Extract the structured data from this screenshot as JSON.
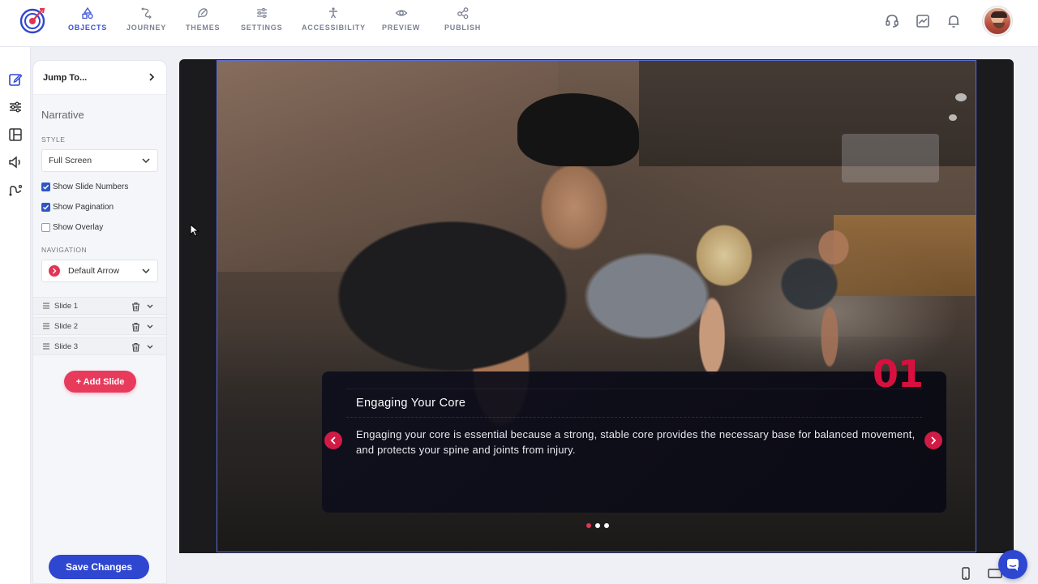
{
  "nav": {
    "items": [
      {
        "label": "OBJECTS",
        "icon": "shapes-icon",
        "active": true
      },
      {
        "label": "JOURNEY",
        "icon": "route-icon"
      },
      {
        "label": "THEMES",
        "icon": "palette-icon"
      },
      {
        "label": "SETTINGS",
        "icon": "sliders-icon"
      },
      {
        "label": "ACCESSIBILITY",
        "icon": "accessibility-icon"
      },
      {
        "label": "PREVIEW",
        "icon": "eye-icon"
      },
      {
        "label": "PUBLISH",
        "icon": "share-icon"
      }
    ]
  },
  "panel": {
    "jump_label": "Jump To...",
    "title": "Narrative",
    "style_label": "STYLE",
    "style_value": "Full Screen",
    "checkboxes": [
      {
        "label": "Show Slide Numbers",
        "checked": true
      },
      {
        "label": "Show Pagination",
        "checked": true
      },
      {
        "label": "Show Overlay",
        "checked": false
      }
    ],
    "navigation_label": "NAVIGATION",
    "navigation_value": "Default Arrow",
    "slides": [
      {
        "label": "Slide 1"
      },
      {
        "label": "Slide 2"
      },
      {
        "label": "Slide 3"
      }
    ],
    "add_slide_label": "+ Add Slide",
    "save_label": "Save Changes"
  },
  "slide": {
    "number": "01",
    "title": "Engaging Your Core",
    "body": "Engaging your core is essential because a strong, stable core provides the necessary base for balanced movement, and protects your spine and joints from injury.",
    "pagination": {
      "total": 3,
      "active": 1
    }
  },
  "colors": {
    "accent_blue": "#2f46d1",
    "accent_red": "#e23553",
    "slide_number_red": "#d8103f"
  }
}
